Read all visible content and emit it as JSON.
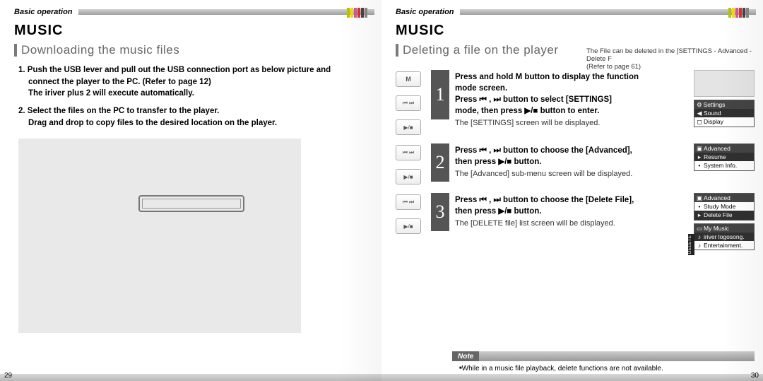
{
  "header": {
    "category": "Basic operation"
  },
  "left": {
    "section": "MUSIC",
    "subhead": "Downloading the music files",
    "para1a": "1. Push the USB lever and pull out the USB connection port as below picture and",
    "para1b": "connect the player to the PC. (Refer to page 12)",
    "para1c": "The iriver plus 2 will execute automatically.",
    "para2a": "2. Select the files on the PC to transfer to the player.",
    "para2b": "Drag and drop to copy files to the desired location on the player.",
    "pagenum": "29"
  },
  "right": {
    "section": "MUSIC",
    "subhead": "Deleting a file on the player",
    "subnote1": "The File can be deleted in the [SETTINGS - Advanced - Delete F",
    "subnote2": "(Refer to page 61)",
    "step1": {
      "l1a": "Press and hold ",
      "l1b": " button to display the function",
      "l2": "mode screen.",
      "l3a": "Press ",
      "l3b": " , ",
      "l3c": " button to select [SETTINGS]",
      "l4": "mode, then press  ▶/■ button to enter.",
      "sub": "The [SETTINGS] screen will be displayed."
    },
    "step2": {
      "l1a": "Press ",
      "l1b": " , ",
      "l1c": " button to choose the [Advanced],",
      "l2": "then press  ▶/■  button.",
      "sub": "The [Advanced] sub-menu screen will be displayed."
    },
    "step3": {
      "l1a": "Press ",
      "l1b": " , ",
      "l1c": " button to choose the [Delete File],",
      "l2": "then press  ▶/■  button.",
      "sub": "The [DELETE file] list screen will be displayed."
    },
    "screens": {
      "settings": {
        "title": "Settings",
        "r1": "Sound",
        "r2": "Display"
      },
      "adv1": {
        "title": "Advanced",
        "r1": "Resume",
        "r2": "System Info."
      },
      "adv2": {
        "title": "Advanced",
        "r1": "Study Mode",
        "r2": "Delete File"
      },
      "file": {
        "title": "My Music",
        "r1": "iriver logosong.",
        "r2": "Entertainment.",
        "tab": "DELETE"
      }
    },
    "note_label": "Note",
    "note_text": "While in a music file playback, delete functions are not available.",
    "pagenum": "30"
  },
  "icons": {
    "m": "M",
    "rew": "⏮",
    "fwd": "⏭",
    "playstop": "▶/■",
    "sound": "◀",
    "display": "◻",
    "folder": "▣",
    "advarrow": "▸",
    "dot": "•",
    "foldericon": "▭",
    "musicnote": "♪"
  }
}
